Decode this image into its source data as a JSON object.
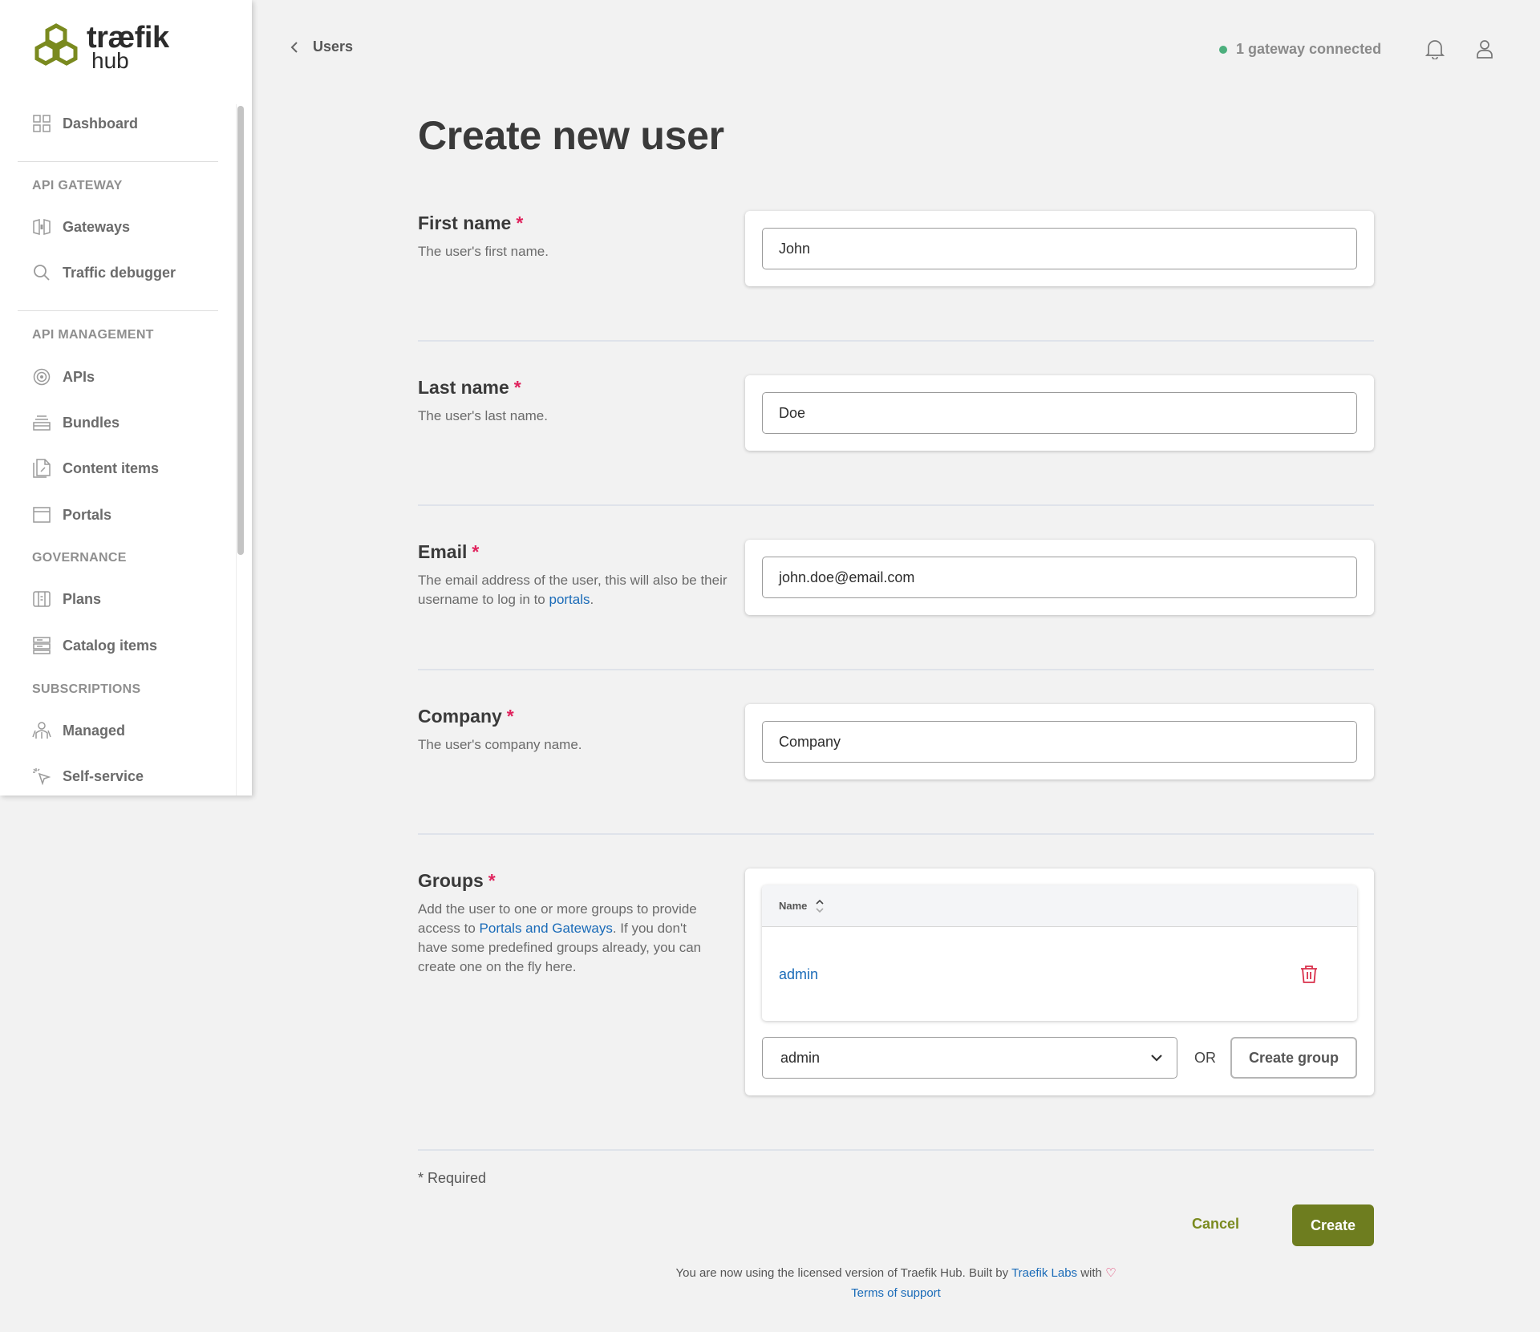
{
  "brand": {
    "name": "træfik",
    "sub": "hub",
    "accent": "#6e7d1f"
  },
  "sidebar": {
    "dashboard": "Dashboard",
    "sections": {
      "api_gateway": "API GATEWAY",
      "api_management": "API MANAGEMENT",
      "governance": "GOVERNANCE",
      "subscriptions": "SUBSCRIPTIONS"
    },
    "items": {
      "gateways": "Gateways",
      "traffic_debugger": "Traffic debugger",
      "apis": "APIs",
      "bundles": "Bundles",
      "content_items": "Content items",
      "portals": "Portals",
      "plans": "Plans",
      "catalog_items": "Catalog items",
      "managed": "Managed",
      "self_service": "Self-service"
    }
  },
  "header": {
    "back_label": "Users",
    "gateway_status": "1 gateway connected",
    "status_color": "#4caf7d"
  },
  "page": {
    "title": "Create new user"
  },
  "form": {
    "required_mark": "*",
    "first_name": {
      "label": "First name",
      "desc": "The user's first name.",
      "value": "John"
    },
    "last_name": {
      "label": "Last name",
      "desc": "The user's last name.",
      "value": "Doe"
    },
    "email": {
      "label": "Email",
      "desc_before": "The email address of the user, this will also be their username to log in to ",
      "desc_link": "portals",
      "desc_after": ".",
      "value": "john.doe@email.com"
    },
    "company": {
      "label": "Company",
      "desc": "The user's company name.",
      "value": "Company"
    },
    "groups": {
      "label": "Groups",
      "desc_before": "Add the user to one or more groups to provide access to ",
      "desc_link": "Portals and Gateways",
      "desc_after": ". If you don't have some predefined groups already, you can create one on the fly here.",
      "table_header": "Name",
      "rows": [
        "admin"
      ],
      "select_value": "admin",
      "or_label": "OR",
      "create_group": "Create group"
    },
    "required_note": "* Required",
    "cancel": "Cancel",
    "create": "Create"
  },
  "footer": {
    "text_before": "You are now using the licensed version of Traefik Hub. Built by ",
    "link": "Traefik Labs",
    "text_after": " with ",
    "heart": "♡",
    "terms": "Terms of support"
  }
}
